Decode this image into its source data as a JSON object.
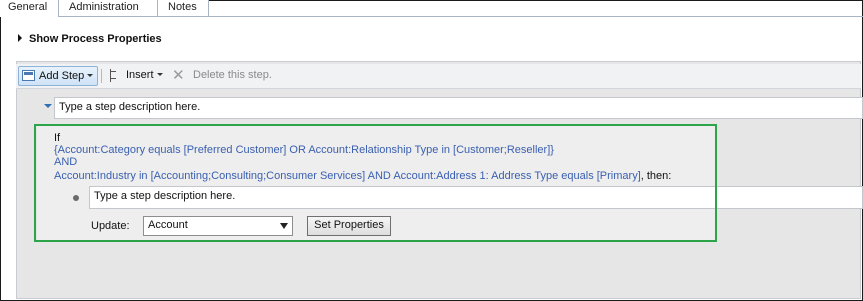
{
  "tabs": [
    {
      "label": "General"
    },
    {
      "label": "Administration"
    },
    {
      "label": "Notes"
    }
  ],
  "process": {
    "show_properties_label": "Show Process Properties"
  },
  "toolbar": {
    "add_step_label": "Add Step",
    "insert_label": "Insert",
    "delete_label": "Delete this step."
  },
  "step": {
    "description_placeholder": "Type a step description here."
  },
  "condition": {
    "if_label": "If",
    "clause1": "{Account:Category equals [Preferred Customer] OR Account:Relationship Type in [Customer;Reseller]}",
    "and_label": "AND",
    "clause2": "Account:Industry in [Accounting;Consulting;Consumer Services] AND Account:Address 1: Address Type equals [Primary]",
    "then_label": ", then:"
  },
  "substep": {
    "description_placeholder": "Type a step description here.",
    "update_label": "Update:",
    "update_entity": "Account",
    "set_properties_label": "Set Properties"
  },
  "colors": {
    "highlight_border": "#2ca44a",
    "condition_text": "#3a5fb0"
  }
}
